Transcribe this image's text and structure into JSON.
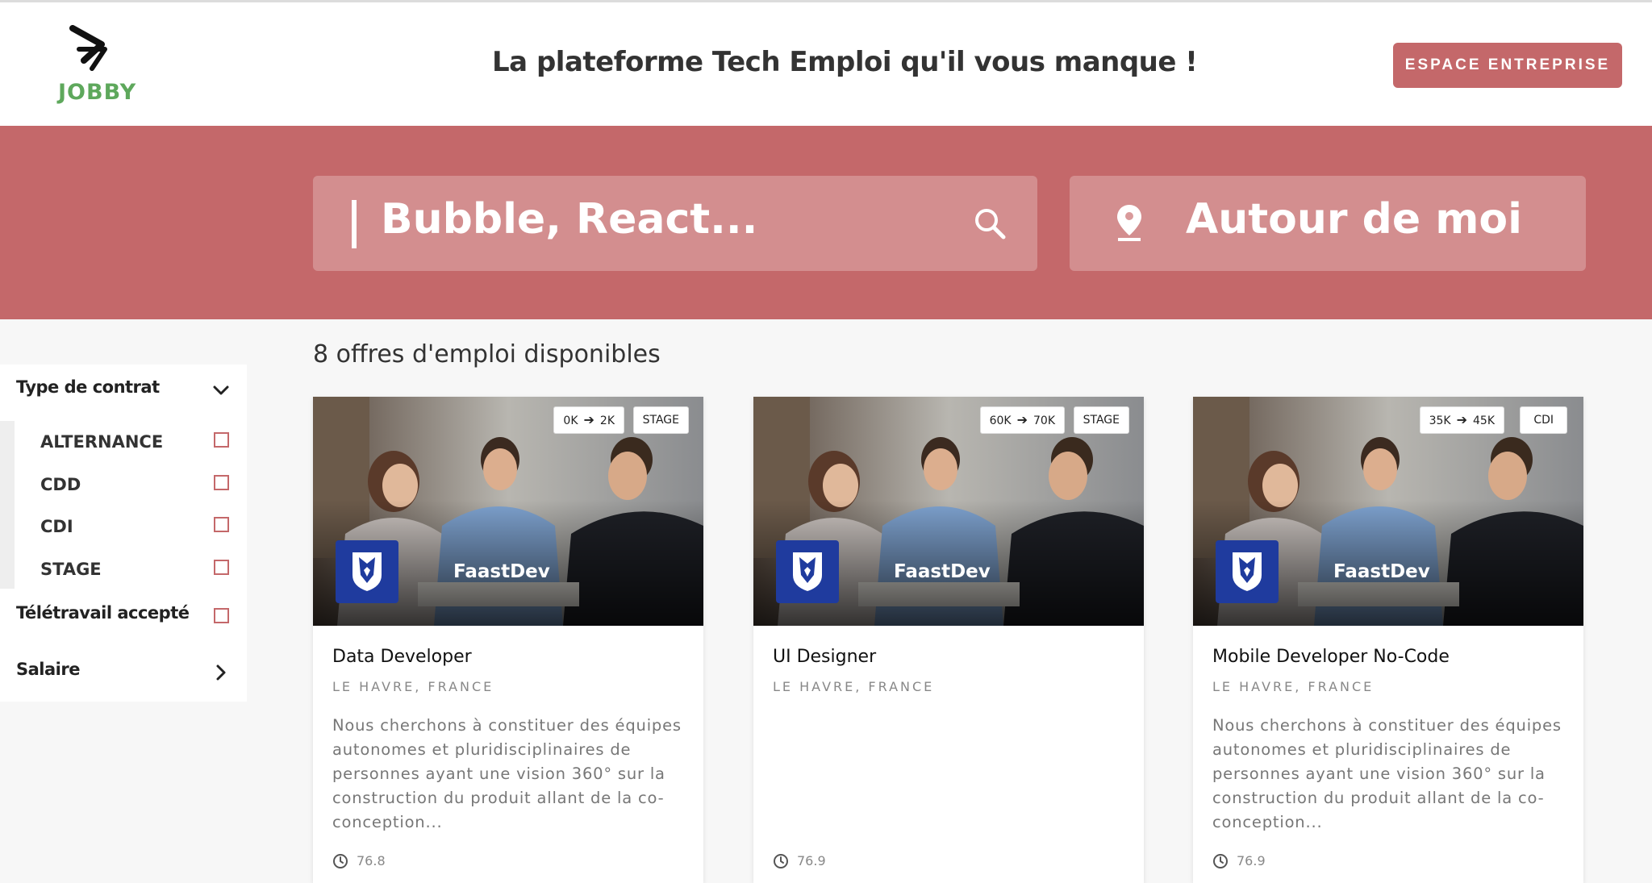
{
  "header": {
    "logo_text": "JOBBY",
    "tagline": "La plateforme Tech Emploi qu'il vous manque !",
    "cta_label": "ESPACE ENTREPRISE"
  },
  "search": {
    "query_placeholder": "Bubble, React...",
    "location_placeholder": "Autour de moi"
  },
  "filters": {
    "contract_type": {
      "label": "Type de contrat",
      "options": [
        {
          "label": "ALTERNANCE",
          "checked": false
        },
        {
          "label": "CDD",
          "checked": false
        },
        {
          "label": "CDI",
          "checked": false
        },
        {
          "label": "STAGE",
          "checked": false
        }
      ]
    },
    "remote": {
      "label": "Télétravail accepté",
      "checked": false
    },
    "salary": {
      "label": "Salaire"
    }
  },
  "results": {
    "count_text": "8 offres d'emploi disponibles"
  },
  "jobs": [
    {
      "salary_min": "0K",
      "salary_max": "2K",
      "contract": "STAGE",
      "company": "FaastDev",
      "title": "Data Developer",
      "location": "LE HAVRE, FRANCE",
      "description": "Nous cherchons à constituer des équipes autonomes et pluridisciplinaires de personnes ayant une vision 360° sur la construction du produit allant de la co-conception...",
      "meta": "76.8"
    },
    {
      "salary_min": "60K",
      "salary_max": "70K",
      "contract": "STAGE",
      "company": "FaastDev",
      "title": "UI Designer",
      "location": "LE HAVRE, FRANCE",
      "description": "",
      "meta": "76.9"
    },
    {
      "salary_min": "35K",
      "salary_max": "45K",
      "contract": "CDI",
      "company": "FaastDev",
      "title": "Mobile Developer No-Code",
      "location": "LE HAVRE, FRANCE",
      "description": "Nous cherchons à constituer des équipes autonomes et pluridisciplinaires de personnes ayant une vision 360° sur la construction du produit allant de la co-conception...",
      "meta": "76.9"
    }
  ],
  "colors": {
    "accent": "#c4686a",
    "logo_green": "#5ea85c",
    "company_blue": "#1f3b9e"
  },
  "icons": [
    "jobby-logo-icon",
    "search-icon",
    "location-pin-icon",
    "chevron-down-icon",
    "chevron-right-icon",
    "arrow-right-icon",
    "shield-logo-icon",
    "clock-icon"
  ]
}
